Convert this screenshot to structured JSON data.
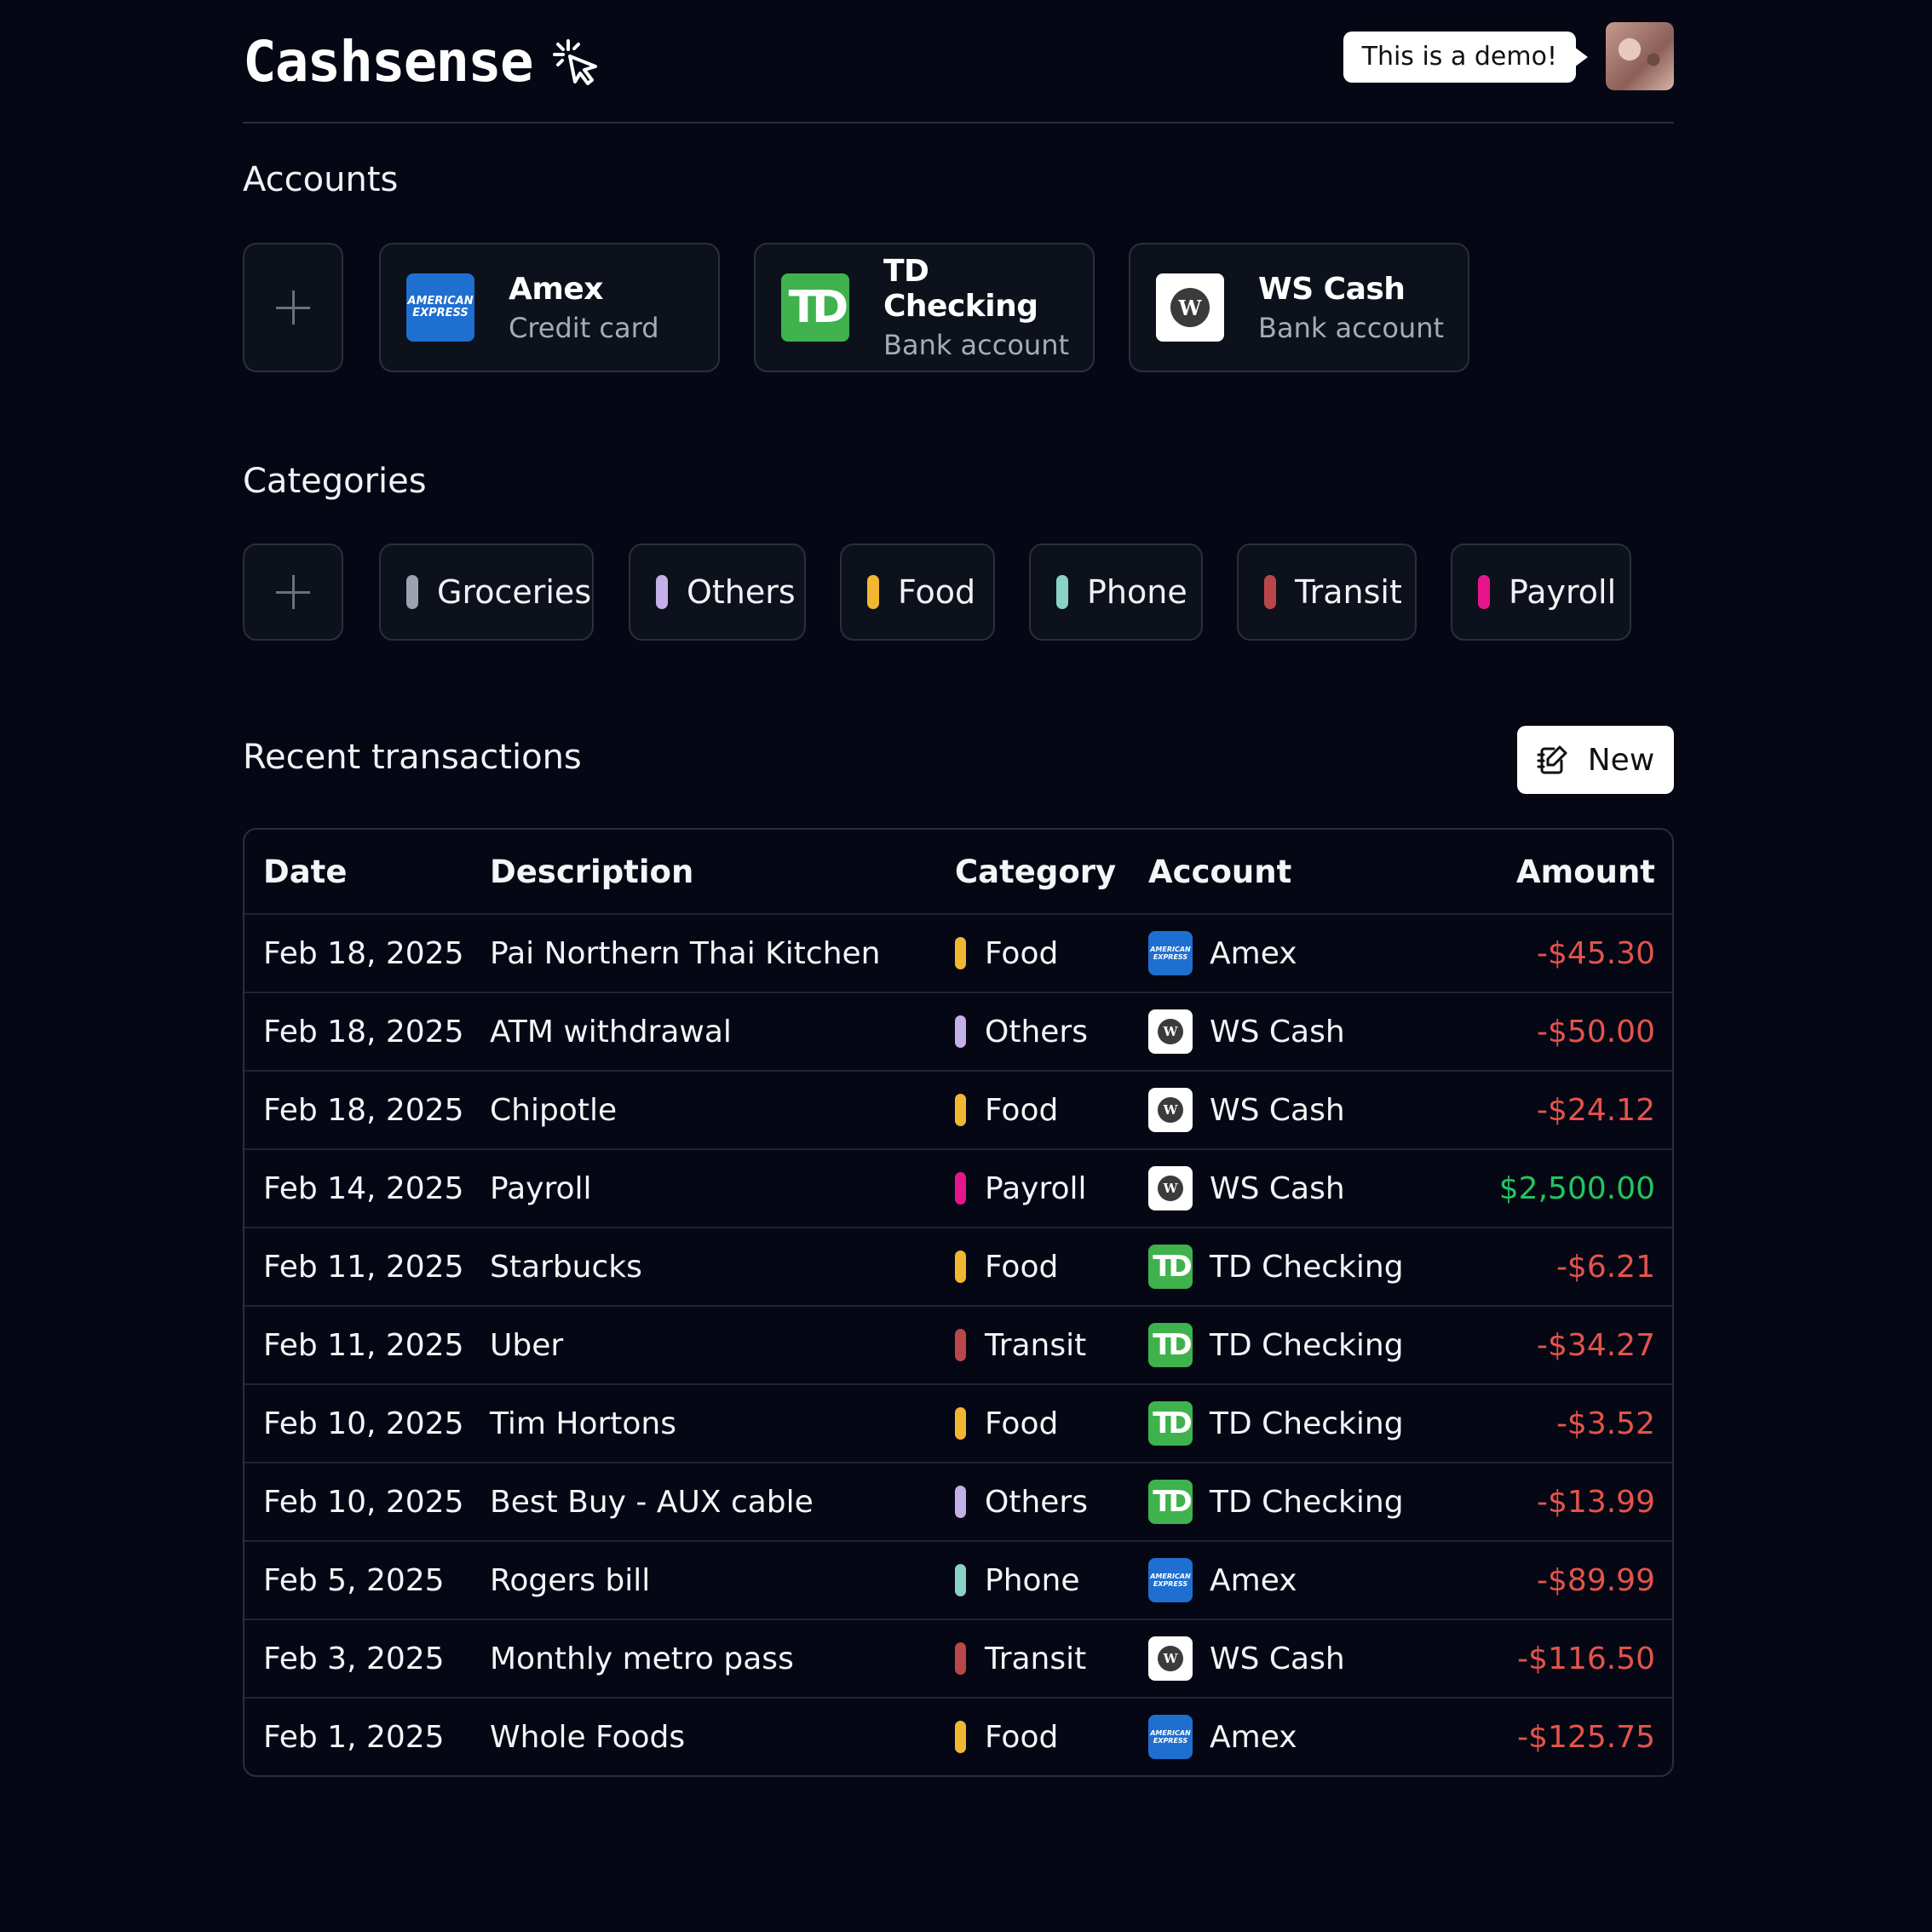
{
  "app": {
    "name": "Cashsense",
    "demo_notice": "This is a demo!"
  },
  "accounts": {
    "title": "Accounts",
    "items": [
      {
        "name": "Amex",
        "type": "Credit card",
        "logo": "AMERICAN EXPRESS"
      },
      {
        "name": "TD Checking",
        "type": "Bank account",
        "logo": "TD"
      },
      {
        "name": "WS Cash",
        "type": "Bank account",
        "logo": "W"
      }
    ]
  },
  "categories": {
    "title": "Categories",
    "items": [
      {
        "label": "Groceries",
        "color": "#9ca3af"
      },
      {
        "label": "Others",
        "color": "#c4b0e8"
      },
      {
        "label": "Food",
        "color": "#f2b732"
      },
      {
        "label": "Phone",
        "color": "#8ad1c6"
      },
      {
        "label": "Transit",
        "color": "#b9474a"
      },
      {
        "label": "Payroll",
        "color": "#e6158c"
      }
    ]
  },
  "transactions": {
    "title": "Recent transactions",
    "new_label": "New",
    "columns": {
      "date": "Date",
      "description": "Description",
      "category": "Category",
      "account": "Account",
      "amount": "Amount"
    },
    "rows": [
      {
        "date": "Feb 18, 2025",
        "description": "Pai Northern Thai Kitchen",
        "category": "Food",
        "account": "Amex",
        "amount": "-$45.30"
      },
      {
        "date": "Feb 18, 2025",
        "description": "ATM withdrawal",
        "category": "Others",
        "account": "WS Cash",
        "amount": "-$50.00"
      },
      {
        "date": "Feb 18, 2025",
        "description": "Chipotle",
        "category": "Food",
        "account": "WS Cash",
        "amount": "-$24.12"
      },
      {
        "date": "Feb 14, 2025",
        "description": "Payroll",
        "category": "Payroll",
        "account": "WS Cash",
        "amount": "$2,500.00"
      },
      {
        "date": "Feb 11, 2025",
        "description": "Starbucks",
        "category": "Food",
        "account": "TD Checking",
        "amount": "-$6.21"
      },
      {
        "date": "Feb 11, 2025",
        "description": "Uber",
        "category": "Transit",
        "account": "TD Checking",
        "amount": "-$34.27"
      },
      {
        "date": "Feb 10, 2025",
        "description": "Tim Hortons",
        "category": "Food",
        "account": "TD Checking",
        "amount": "-$3.52"
      },
      {
        "date": "Feb 10, 2025",
        "description": "Best Buy - AUX cable",
        "category": "Others",
        "account": "TD Checking",
        "amount": "-$13.99"
      },
      {
        "date": "Feb 5, 2025",
        "description": "Rogers bill",
        "category": "Phone",
        "account": "Amex",
        "amount": "-$89.99"
      },
      {
        "date": "Feb 3, 2025",
        "description": "Monthly metro pass",
        "category": "Transit",
        "account": "WS Cash",
        "amount": "-$116.50"
      },
      {
        "date": "Feb 1, 2025",
        "description": "Whole Foods",
        "category": "Food",
        "account": "Amex",
        "amount": "-$125.75"
      }
    ]
  },
  "colors": {
    "background": "#050814",
    "negative": "#e5534b",
    "positive": "#22c55e",
    "amex": "#1f6fd1",
    "td": "#3fb24d"
  },
  "icons": [
    "cursor-click-icon",
    "plus-icon",
    "new-note-icon"
  ]
}
